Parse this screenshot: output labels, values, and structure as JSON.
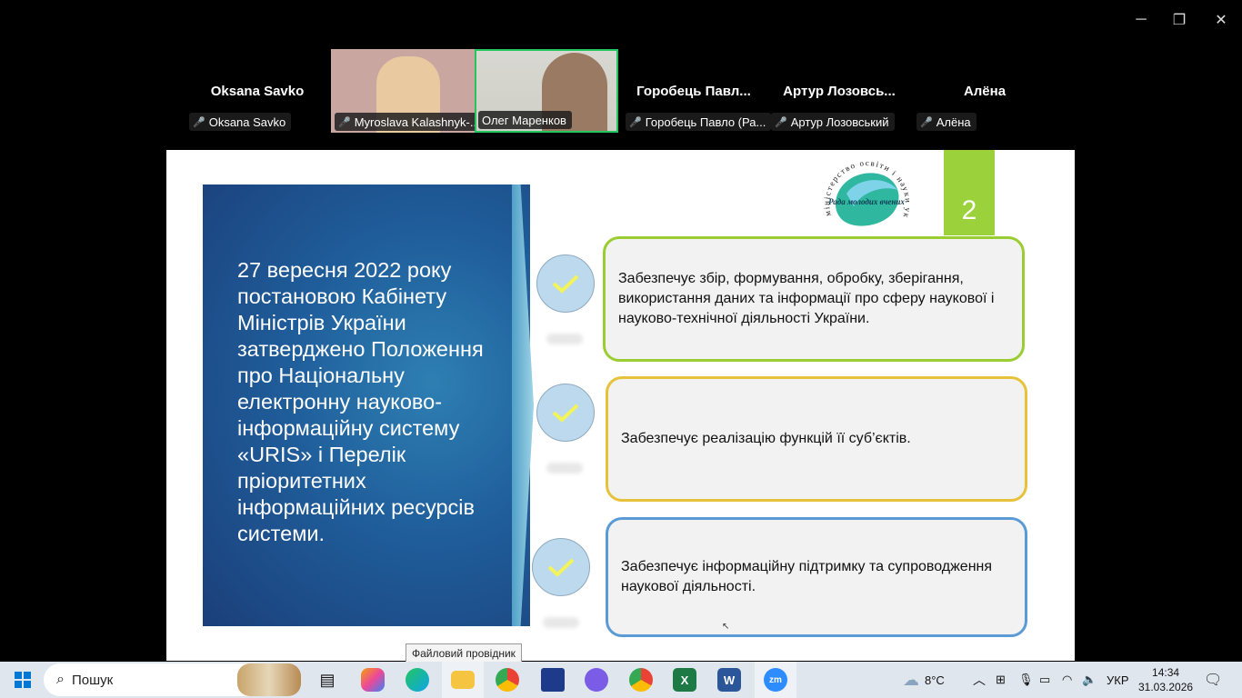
{
  "window_controls": {
    "minimize": "─",
    "restore": "❐",
    "close": "✕"
  },
  "participants": [
    {
      "display_name": "Oksana Savko",
      "tag": "Oksana Savko",
      "video": false
    },
    {
      "display_name": "",
      "tag": "Myroslava Kalashnyk-...",
      "video": true
    },
    {
      "display_name": "",
      "tag": "Олег Маренков",
      "video": true,
      "active_speaker": true
    },
    {
      "display_name": "Горобець  Павл...",
      "tag": "Горобець Павло (Ра...",
      "video": false
    },
    {
      "display_name": "Артур  Лозовсь...",
      "tag": "Артур Лозовський",
      "video": false
    },
    {
      "display_name": "Алёна",
      "tag": "Алёна",
      "video": false
    }
  ],
  "slide": {
    "number": "2",
    "logo": {
      "ring_text": "міністерство освіти і науки україни",
      "inner_text": "Рада молодих вчених"
    },
    "main_text": "27 вересня 2022 року постановою Кабінету Міністрів України затверджено Положення про Національну електронну науково-інформаційну систему «URIS» і Перелік пріоритетних інформаційних ресурсів системи.",
    "boxes": [
      {
        "text": "Забезпечує збір, формування, обробку, зберігання, використання даних та інформації про сферу наукової і науково-технічної діяльності України.",
        "border": "#9acd32"
      },
      {
        "text": "Забезпечує реалізацію функцій її суб’єктів.",
        "border": "#e6c23a"
      },
      {
        "text": "Забезпечує інформаційну підтримку та супроводження наукової діяльності.",
        "border": "#5b9bd5"
      }
    ],
    "panel_color": "#1f5d9a",
    "accent_color": "#9bd13a"
  },
  "tooltip": "Файловий провідник",
  "taskbar": {
    "search_placeholder": "Пошук",
    "apps": [
      "widgets-icon",
      "copilot-icon",
      "edge-icon",
      "file-explorer-icon",
      "chrome-icon",
      "save-icon",
      "viber-icon",
      "chrome-icon",
      "excel-icon",
      "word-icon",
      "zoom-icon"
    ],
    "weather": "8°C",
    "language": "УКР",
    "time": "14:34",
    "date": "31.03.2026"
  }
}
